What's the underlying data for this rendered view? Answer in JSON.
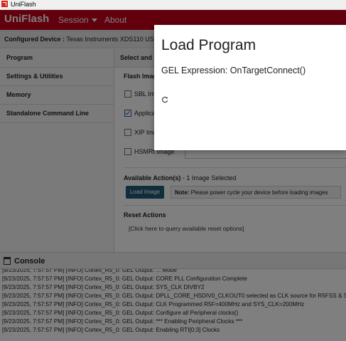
{
  "window": {
    "title": "UniFlash"
  },
  "app": {
    "brand": "UniFlash",
    "menu": {
      "session": "Session",
      "about": "About"
    },
    "colors": {
      "brand_red": "#c4001a",
      "button_blue": "#205b78"
    }
  },
  "device_bar": {
    "label": "Configured Device :",
    "value": "Texas Instruments XDS110 USB Deb"
  },
  "sidebar": {
    "items": [
      {
        "label": "Program"
      },
      {
        "label": "Settings & Utilities"
      },
      {
        "label": "Memory"
      },
      {
        "label": "Standalone Command Line"
      }
    ]
  },
  "main": {
    "header": "Select and L",
    "flash_images_title": "Flash Imag",
    "images": [
      {
        "label": "SBL Imag",
        "checked": false
      },
      {
        "label": "Applicati",
        "checked": true
      },
      {
        "label": "XIP Imag",
        "checked": false
      },
      {
        "label": "HSMRt Image",
        "checked": false
      }
    ],
    "actions_title": "Available Action(s)",
    "actions_suffix": " - 1 Image Selected",
    "load_button": "Load Image",
    "note_label": "Note:",
    "note_text": " Please power cycle your device before loading images",
    "reset_title": "Reset Actions",
    "reset_link": "[Click here to query available reset options]"
  },
  "console": {
    "title": "Console",
    "lines": [
      "[9/23/2025, 7:57:57 PM] [INFO] Cortex_R5_0: GEL Output: ... Mode",
      "[9/23/2025, 7:57:57 PM] [INFO] Cortex_R5_0: GEL Output: CORE PLL Configuration Complete",
      "[9/23/2025, 7:57:57 PM] [INFO] Cortex_R5_0: GEL Output: SYS_CLK DIVBY2",
      "[9/23/2025, 7:57:57 PM] [INFO] Cortex_R5_0: GEL Output: DPLL_CORE_HSDIV0_CLKOUT0 selected as CLK source for R5FSS & SYS",
      "[9/23/2025, 7:57:57 PM] [INFO] Cortex_R5_0: GEL Output: CLK Programmed R5F=400MHz and SYS_CLK=200MHz",
      "[9/23/2025, 7:57:57 PM] [INFO] Cortex_R5_0: GEL Output: Configure all Peripheral clocks()",
      "[9/23/2025, 7:57:57 PM] [INFO] Cortex_R5_0: GEL Output: *** Enabling Peripheral Clocks ***",
      "[9/23/2025, 7:57:57 PM] [INFO] Cortex_R5_0: GEL Output: Enabling RTI[0:3] Clocks"
    ]
  },
  "dialog": {
    "title": "Load Program",
    "message": "GEL Expression: OnTargetConnect()",
    "spinner_icon": "refresh-spinner-icon"
  }
}
